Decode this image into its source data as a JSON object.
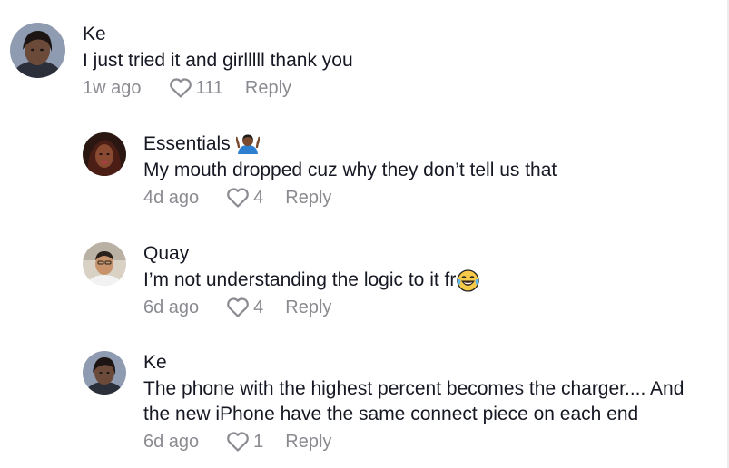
{
  "comments": [
    {
      "username": "Ke",
      "text": "I just tried it and girlllll thank you",
      "time": "1w ago",
      "likes": "111",
      "reply_label": "Reply",
      "avatar_icon": "user-avatar-photo"
    },
    {
      "username": "Essentials",
      "text": "My mouth dropped cuz why they don’t tell us that",
      "time": "4d ago",
      "likes": "4",
      "reply_label": "Reply",
      "avatar_icon": "user-avatar-photo",
      "name_emoji": "person-shrugging-emoji"
    },
    {
      "username": "Quay",
      "text": "I’m not understanding the logic to it fr",
      "time": "6d ago",
      "likes": "4",
      "reply_label": "Reply",
      "avatar_icon": "user-avatar-photo",
      "text_emoji": "tears-of-joy-emoji"
    },
    {
      "username": "Ke",
      "text_line1": "The phone with the highest percent becomes the charger.... And",
      "text_line2": "the new iPhone have the same connect piece on each end",
      "time": "6d ago",
      "likes": "1",
      "reply_label": "Reply",
      "avatar_icon": "user-avatar-photo"
    }
  ],
  "colors": {
    "text": "#161823",
    "secondary": "#8a8b91",
    "background": "#ffffff"
  }
}
